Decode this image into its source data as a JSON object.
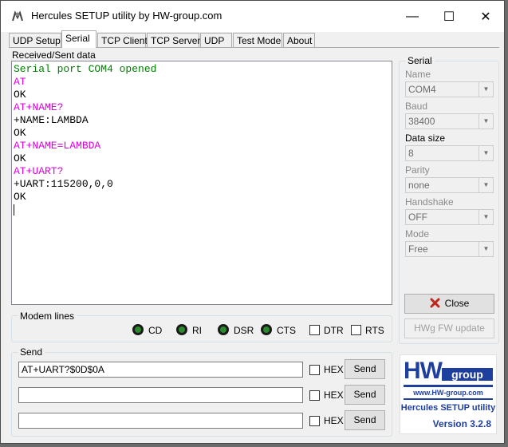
{
  "window": {
    "title": "Hercules SETUP utility by HW-group.com"
  },
  "titlebar_buttons": {
    "minimize": "—",
    "maximize": "☐",
    "close": "✕"
  },
  "tabs": [
    {
      "label": "UDP Setup"
    },
    {
      "label": "Serial"
    },
    {
      "label": "TCP Client"
    },
    {
      "label": "TCP Server"
    },
    {
      "label": "UDP"
    },
    {
      "label": "Test Mode"
    },
    {
      "label": "About"
    }
  ],
  "active_tab": "Serial",
  "received": {
    "label": "Received/Sent data",
    "lines": [
      {
        "text": "Serial port COM4 opened",
        "color": "#008000"
      },
      {
        "text": "AT",
        "color": "#e000e0"
      },
      {
        "text": "OK",
        "color": "#000000"
      },
      {
        "text": "AT+NAME?",
        "color": "#e000e0"
      },
      {
        "text": "+NAME:LAMBDA",
        "color": "#000000"
      },
      {
        "text": "OK",
        "color": "#000000"
      },
      {
        "text": "AT+NAME=LAMBDA",
        "color": "#e000e0"
      },
      {
        "text": "OK",
        "color": "#000000"
      },
      {
        "text": "AT+UART?",
        "color": "#e000e0"
      },
      {
        "text": "+UART:115200,0,0",
        "color": "#000000"
      },
      {
        "text": "OK",
        "color": "#000000"
      }
    ]
  },
  "modem": {
    "title": "Modem lines",
    "leds": [
      {
        "label": "CD"
      },
      {
        "label": "RI"
      },
      {
        "label": "DSR"
      },
      {
        "label": "CTS"
      }
    ],
    "checks": [
      {
        "label": "DTR"
      },
      {
        "label": "RTS"
      }
    ]
  },
  "serial": {
    "title": "Serial",
    "name_label": "Name",
    "name_value": "COM4",
    "baud_label": "Baud",
    "baud_value": "38400",
    "datasize_label": "Data size",
    "datasize_value": "8",
    "parity_label": "Parity",
    "parity_value": "none",
    "handshake_label": "Handshake",
    "handshake_value": "OFF",
    "mode_label": "Mode",
    "mode_value": "Free"
  },
  "buttons": {
    "close": "Close",
    "fw_update": "HWg FW update"
  },
  "send": {
    "title": "Send",
    "rows": [
      {
        "value": "AT+UART?$0D$0A",
        "hex_label": "HEX",
        "send_label": "Send"
      },
      {
        "value": "",
        "hex_label": "HEX",
        "send_label": "Send"
      },
      {
        "value": "",
        "hex_label": "HEX",
        "send_label": "Send"
      }
    ]
  },
  "logo": {
    "hw": "HW",
    "group": "group",
    "url": "www.HW-group.com",
    "product": "Hercules SETUP utility",
    "version": "Version  3.2.8"
  },
  "colors": {
    "accent_blue": "#1f3f9f",
    "close_x_red": "#c0281e",
    "led_green": "#2b8a2b"
  }
}
